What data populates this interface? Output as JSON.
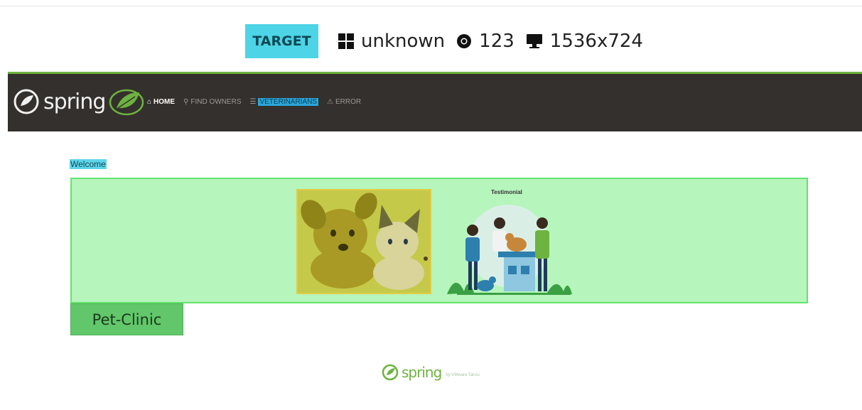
{
  "info_bar": {
    "badge": "TARGET",
    "os": "unknown",
    "browser_version": "123",
    "resolution": "1536x724",
    "icons": [
      "windows-icon",
      "chrome-icon",
      "monitor-icon"
    ]
  },
  "navbar": {
    "brand": "spring",
    "items": [
      {
        "label": "HOME",
        "icon": "home-icon",
        "glyph": "⌂"
      },
      {
        "label": "FIND OWNERS",
        "icon": "search-icon",
        "glyph": "⚲"
      },
      {
        "label": "VETERINARIANS",
        "icon": "list-icon",
        "glyph": "☰"
      },
      {
        "label": "ERROR",
        "icon": "warning-icon",
        "glyph": "⚠"
      }
    ]
  },
  "main": {
    "welcome": "Welcome",
    "testimonial_title": "Testimonial",
    "pet_clinic_button": "Pet-Clinic"
  },
  "footer": {
    "brand": "spring",
    "sub": "by VMware Tanzu"
  },
  "colors": {
    "navbar_bg": "#34302d",
    "spring_green": "#6db33f",
    "target_badge": "#4dd4e6",
    "hero_bg": "#b6f5bc"
  }
}
